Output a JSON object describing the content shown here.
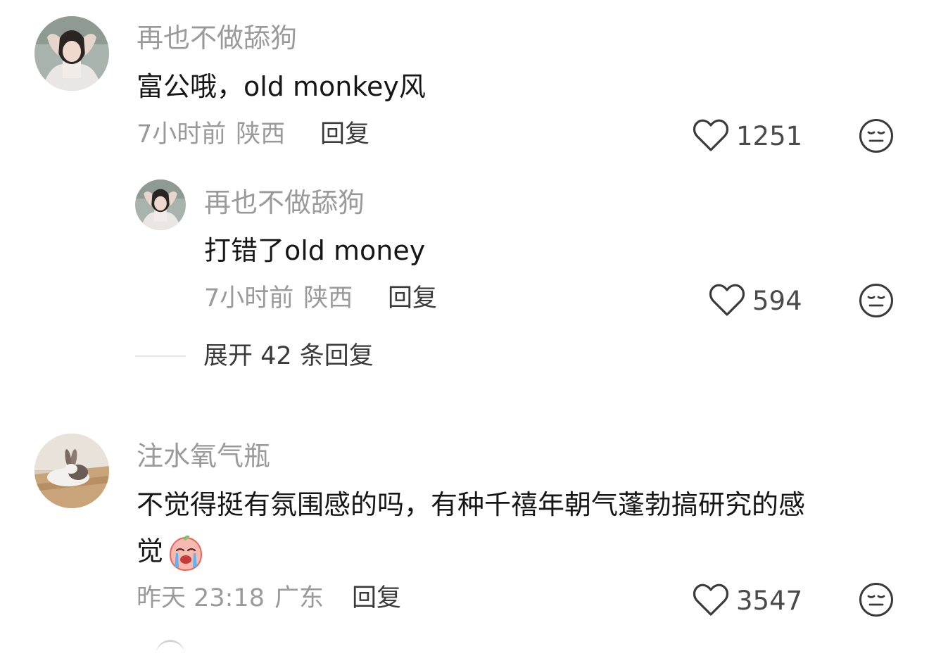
{
  "comments": [
    {
      "username": "再也不做舔狗",
      "text": "富公哦，old monkey风",
      "time": "7小时前",
      "region": "陕西",
      "reply_label": "回复",
      "likes": "1251",
      "avatar": "girl-photo-avatar"
    },
    {
      "username": "注水氧气瓶",
      "text_line1": "不觉得挺有氛围感的吗，有种千禧年朝气蓬勃搞研究的感",
      "text_line2": "觉",
      "emoji": "crying-face-emoji",
      "time": "昨天 23:18",
      "region": "广东",
      "reply_label": "回复",
      "likes": "3547",
      "avatar": "rabbit-photo-avatar"
    }
  ],
  "reply": {
    "username": "再也不做舔狗",
    "text": "打错了old money",
    "time": "7小时前",
    "region": "陕西",
    "reply_label": "回复",
    "likes": "594",
    "avatar": "girl-photo-avatar"
  },
  "expand_replies_label": "展开 42 条回复",
  "icons": {
    "like": "heart-outline-icon",
    "dislike": "meh-face-icon"
  },
  "colors": {
    "username": "#9a9a9a",
    "content": "#161616",
    "meta": "#9a9a9a",
    "action": "#3a3a3a"
  }
}
